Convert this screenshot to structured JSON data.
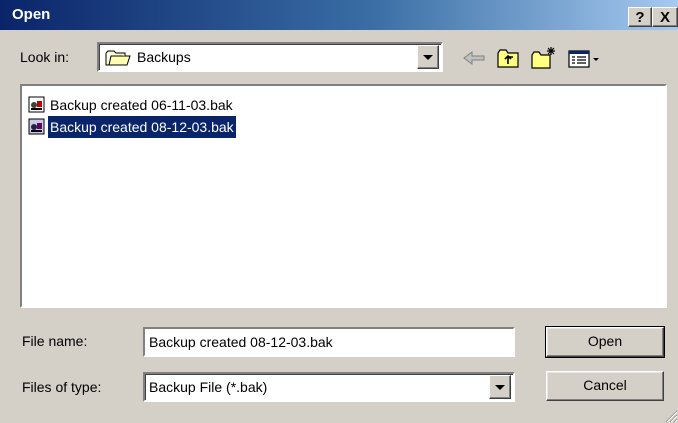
{
  "window": {
    "title": "Open",
    "help_label": "?",
    "close_label": "X"
  },
  "lookin": {
    "label": "Look in:",
    "value": "Backups"
  },
  "files": [
    {
      "name": "Backup created 06-11-03.bak",
      "selected": false
    },
    {
      "name": "Backup created 08-12-03.bak",
      "selected": true
    }
  ],
  "filename": {
    "label": "File name:",
    "value": "Backup created 08-12-03.bak"
  },
  "filetype": {
    "label": "Files of type:",
    "value": "Backup File (*.bak)"
  },
  "buttons": {
    "open": "Open",
    "cancel": "Cancel"
  },
  "colors": {
    "title_start": "#0a246a",
    "title_end": "#a6caf0",
    "selection": "#0a246a",
    "face": "#d4d0c8"
  },
  "icons": {
    "lookin_folder": "folder-icon",
    "back": "back-arrow-icon",
    "up": "up-folder-icon",
    "new_folder": "new-folder-icon",
    "view_menu": "view-menu-icon",
    "file": "backup-file-icon"
  }
}
